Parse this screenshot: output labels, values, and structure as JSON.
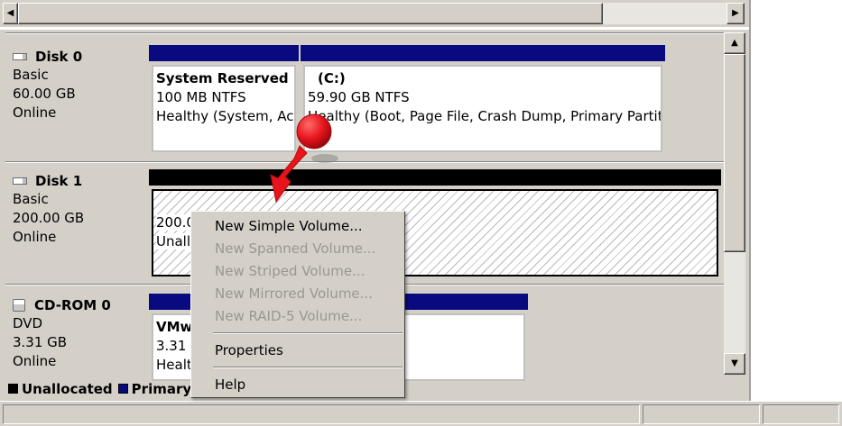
{
  "disks": [
    {
      "name": "Disk 0",
      "type": "Basic",
      "size": "60.00 GB",
      "status": "Online",
      "partitions": [
        {
          "name": "System Reserved",
          "size_fs": "100 MB NTFS",
          "status": "Healthy (System, Ac",
          "bar_color": "#0a0a80"
        },
        {
          "name": "(C:)",
          "size_fs": "59.90 GB NTFS",
          "status": "Healthy (Boot, Page File, Crash Dump, Primary Partit",
          "bar_color": "#0a0a80"
        }
      ]
    },
    {
      "name": "Disk 1",
      "type": "Basic",
      "size": "200.00 GB",
      "status": "Online",
      "partitions": [
        {
          "name": "",
          "size_fs": "200.0",
          "status": "Unall",
          "bar_color": "#000000"
        }
      ]
    },
    {
      "name": "CD-ROM 0",
      "type": "DVD",
      "size": "3.31 GB",
      "status": "Online",
      "partitions": [
        {
          "name": "VMw",
          "size_fs": "3.31",
          "status": "Healt",
          "bar_color": "#0a0a80"
        }
      ]
    }
  ],
  "legend": [
    {
      "label": "Unallocated",
      "color": "#000000"
    },
    {
      "label": "Primary",
      "color": "#0a0a80"
    }
  ],
  "context_menu": {
    "items": [
      {
        "label": "New Simple Volume...",
        "enabled": true
      },
      {
        "label": "New Spanned Volume...",
        "enabled": false
      },
      {
        "label": "New Striped Volume...",
        "enabled": false
      },
      {
        "label": "New Mirrored Volume...",
        "enabled": false
      },
      {
        "label": "New RAID-5 Volume...",
        "enabled": false
      },
      {
        "label": "Properties",
        "enabled": true
      },
      {
        "label": "Help",
        "enabled": true
      }
    ]
  },
  "scroll_glyphs": {
    "left": "◀",
    "right": "▶",
    "up": "▲",
    "down": "▼"
  },
  "colors": {
    "pointer": "#e8141c",
    "selected_border": "#000000",
    "primary": "#0a0a80",
    "unallocated": "#000000"
  },
  "icons": {
    "disk": "hard-disk-icon",
    "cdrom": "cd-drive-icon",
    "pointer": "red-pointer-arrow"
  }
}
